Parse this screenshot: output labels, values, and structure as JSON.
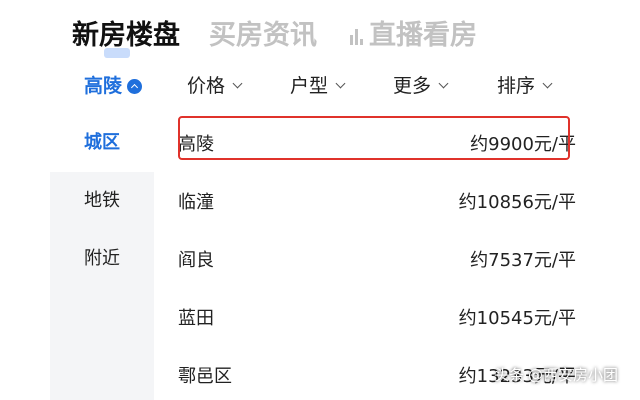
{
  "top_tabs": [
    {
      "label": "新房楼盘"
    },
    {
      "label": "买房资讯"
    },
    {
      "label": "直播看房"
    }
  ],
  "filters": {
    "region": "高陵",
    "price": "价格",
    "layout": "户型",
    "more": "更多",
    "sort": "排序"
  },
  "sidebar": {
    "items": [
      {
        "label": "城区"
      },
      {
        "label": "地铁"
      },
      {
        "label": "附近"
      }
    ]
  },
  "districts": [
    {
      "name": "高陵",
      "price": "约9900元/平"
    },
    {
      "name": "临潼",
      "price": "约10856元/平"
    },
    {
      "name": "阎良",
      "price": "约7537元/平"
    },
    {
      "name": "蓝田",
      "price": "约10545元/平"
    },
    {
      "name": "鄠邑区",
      "price": "约13233元/平"
    }
  ],
  "watermark": {
    "brand": "头条",
    "account": "@西安房小团"
  },
  "colors": {
    "accent": "#1f6fdc",
    "highlight": "#e0322b",
    "sidebar_bg": "#f4f5f7",
    "inactive_tab": "#c2c2c2"
  }
}
